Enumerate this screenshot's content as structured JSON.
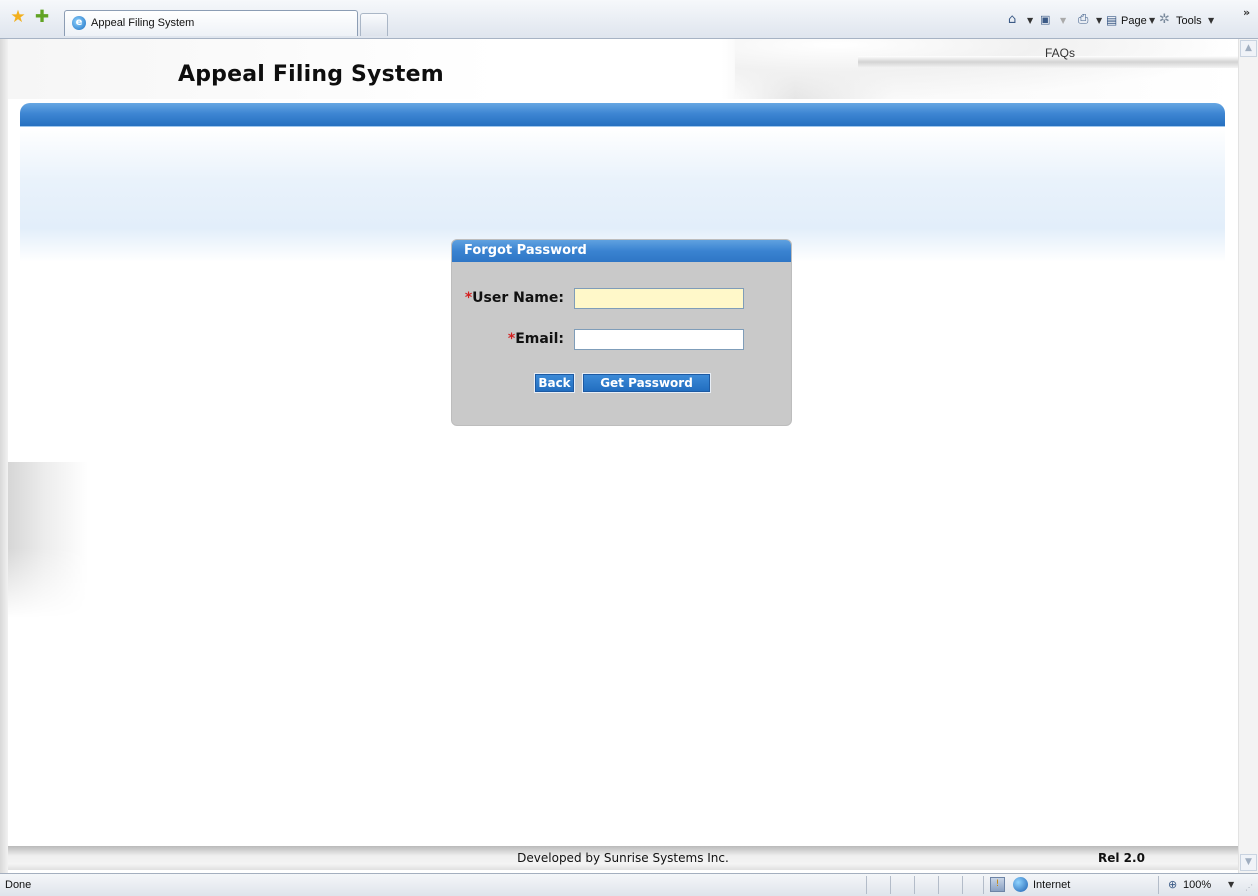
{
  "browser": {
    "tab_title": "Appeal Filing System",
    "toolbar": {
      "page_label": "Page",
      "tools_label": "Tools",
      "overflow": "»"
    },
    "icons": {
      "favorites": "favorites-star-icon",
      "add_favorites": "add-favorites-icon",
      "home": "home-icon",
      "feeds": "feeds-icon",
      "print": "print-icon",
      "page": "page-icon",
      "tools": "tools-gear-icon"
    }
  },
  "header": {
    "site_title": "Appeal Filing System",
    "faq_link": "FAQs"
  },
  "forgot_password": {
    "title": "Forgot Password",
    "required_marker": "*",
    "username_label": "User Name:",
    "username_value": "",
    "email_label": "Email:",
    "email_value": "",
    "back_button": "Back",
    "get_password_button": "Get Password"
  },
  "footer": {
    "developed_by": "Developed by Sunrise Systems Inc.",
    "release": "Rel 2.0"
  },
  "statusbar": {
    "status": "Done",
    "zone": "Internet",
    "zoom": "100%"
  },
  "colors": {
    "accent_blue": "#3a83d1",
    "panel_gray": "#c9c9c9",
    "required_red": "#d32020",
    "username_field_bg": "#fff8c9"
  }
}
